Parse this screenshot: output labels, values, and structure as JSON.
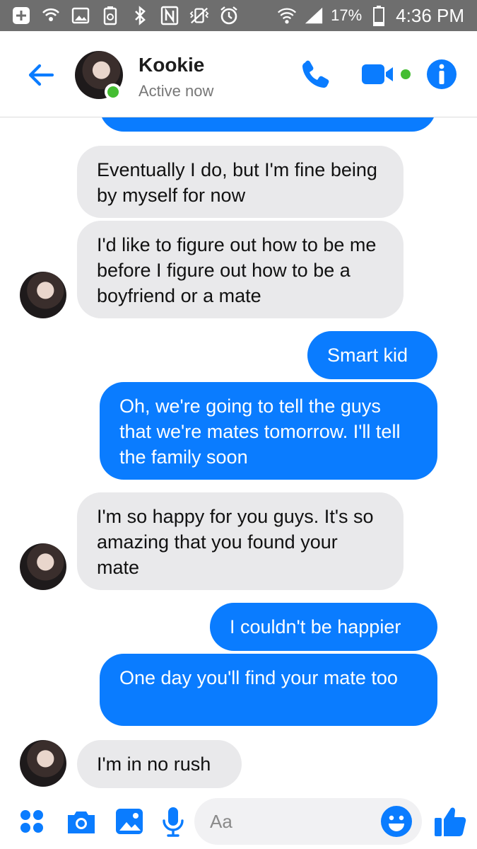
{
  "status_bar": {
    "battery_percent": "17%",
    "time": "4:36 PM"
  },
  "header": {
    "name": "Kookie",
    "status": "Active now"
  },
  "messages": [
    {
      "from": "me",
      "text": ""
    },
    {
      "from": "them",
      "text": "Eventually I do, but I'm fine being by myself for now"
    },
    {
      "from": "them",
      "text": "I'd like to figure out how to be me before I figure out how to be a boyfriend or a mate"
    },
    {
      "from": "me",
      "text": "Smart kid"
    },
    {
      "from": "me",
      "text": "Oh, we're going to tell the guys that we're mates tomorrow. I'll tell the family soon"
    },
    {
      "from": "them",
      "text": "I'm so happy for you guys. It's so amazing that you found your mate"
    },
    {
      "from": "me",
      "text": "I couldn't be happier"
    },
    {
      "from": "me",
      "text": "One day you'll find your mate too"
    },
    {
      "from": "them",
      "text": "I'm in no rush"
    }
  ],
  "composer": {
    "placeholder": "Aa"
  },
  "colors": {
    "accent": "#0a7cff",
    "incoming_bubble": "#e9e9eb",
    "online": "#44bd32",
    "status_bar": "#6e6e6e"
  },
  "icons": [
    "plus-box-icon",
    "wifi-call-icon",
    "image-icon",
    "recycle-icon",
    "bluetooth-icon",
    "nfc-icon",
    "vibrate-icon",
    "alarm-icon",
    "wifi-icon",
    "signal-icon",
    "battery-icon",
    "back-arrow-icon",
    "phone-icon",
    "video-icon",
    "info-icon",
    "apps-icon",
    "camera-icon",
    "gallery-icon",
    "mic-icon",
    "emoji-icon",
    "like-icon"
  ]
}
